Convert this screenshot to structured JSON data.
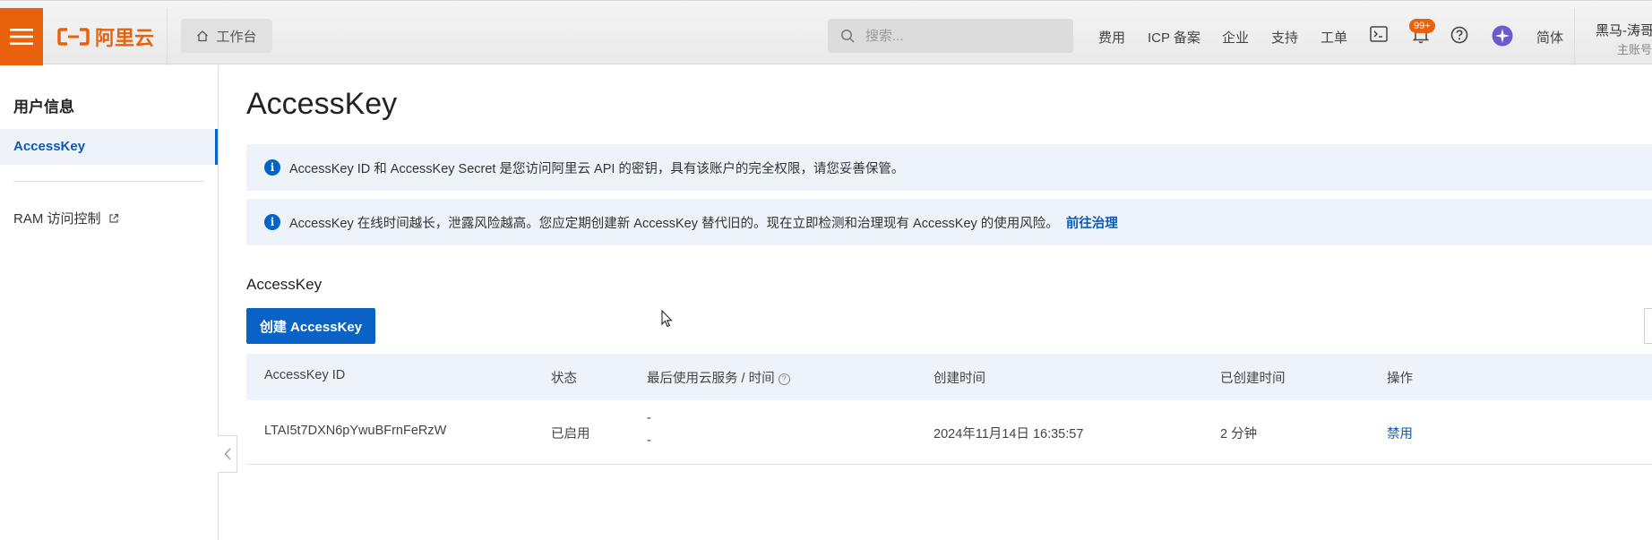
{
  "header": {
    "logo_text": "阿里云",
    "workbench_label": "工作台",
    "search_placeholder": "搜索...",
    "nav": [
      "费用",
      "ICP 备案",
      "企业",
      "支持",
      "工单"
    ],
    "notification_badge": "99+",
    "language": "简体",
    "user_name": "黑马-涛哥",
    "user_sub": "主账号",
    "accent_color": "#e8620e"
  },
  "sidebar": {
    "title": "用户信息",
    "active_item": "AccessKey",
    "ram_link": "RAM 访问控制"
  },
  "main": {
    "page_title": "AccessKey",
    "notice1": "AccessKey ID 和 AccessKey Secret 是您访问阿里云 API 的密钥，具有该账户的完全权限，请您妥善保管。",
    "notice2": "AccessKey 在线时间越长，泄露风险越高。您应定期创建新 AccessKey 替代旧的。现在立即检测和治理现有 AccessKey 的使用风险。",
    "notice2_link": "前往治理",
    "section_title": "AccessKey",
    "create_button": "创建 AccessKey",
    "table": {
      "columns": [
        "AccessKey ID",
        "状态",
        "最后使用云服务 / 时间",
        "创建时间",
        "已创建时间",
        "操作"
      ],
      "rows": [
        {
          "id": "LTAI5t7DXN6pYwuBFrnFeRzW",
          "status": "已启用",
          "last_used_service": "-",
          "last_used_time": "-",
          "created": "2024年11月14日 16:35:57",
          "age": "2 分钟",
          "action": "禁用"
        }
      ]
    }
  }
}
